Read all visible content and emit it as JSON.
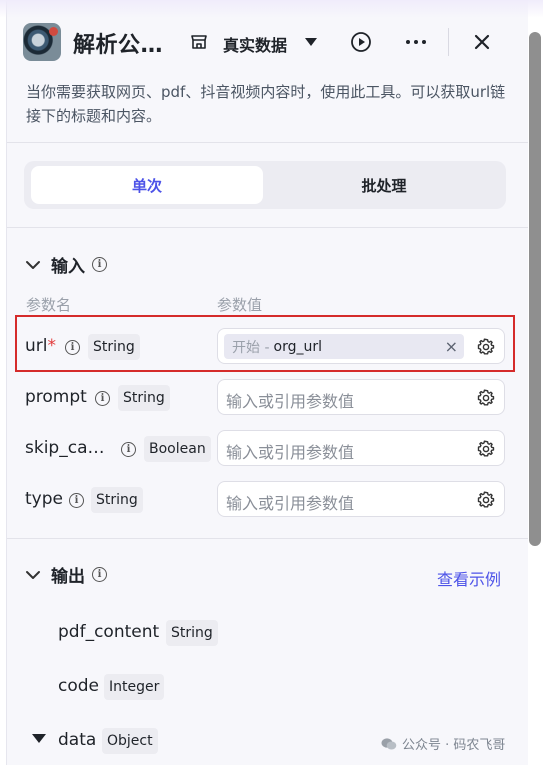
{
  "header": {
    "title": "解析公…",
    "data_mode": "真实数据",
    "icons": [
      "store-icon",
      "caret-down-icon",
      "play-icon",
      "more-icon",
      "close-icon"
    ]
  },
  "description": "当你需要获取网页、pdf、抖音视频内容时，使用此工具。可以获取url链接下的标题和内容。",
  "tabs": {
    "single": "单次",
    "batch": "批处理"
  },
  "input_section": {
    "title": "输入",
    "col_name": "参数名",
    "col_value": "参数值",
    "params": [
      {
        "name": "url",
        "required_mark": "*",
        "type": "String",
        "ref_source": "开始 -",
        "ref_var": "org_url"
      },
      {
        "name": "prompt",
        "type": "String",
        "placeholder": "输入或引用参数值"
      },
      {
        "name": "skip_ca…",
        "type": "Boolean",
        "placeholder": "输入或引用参数值"
      },
      {
        "name": "type",
        "type": "String",
        "placeholder": "输入或引用参数值"
      }
    ]
  },
  "output_section": {
    "title": "输出",
    "example_link": "查看示例",
    "fields": [
      {
        "name": "pdf_content",
        "type": "String"
      },
      {
        "name": "code",
        "type": "Integer"
      },
      {
        "name": "data",
        "type": "Object"
      }
    ]
  },
  "watermark": "公众号 · 码农飞哥",
  "colors": {
    "accent": "#4d53e8",
    "highlight_border": "#d52b2b",
    "required": "#e23b3b"
  }
}
